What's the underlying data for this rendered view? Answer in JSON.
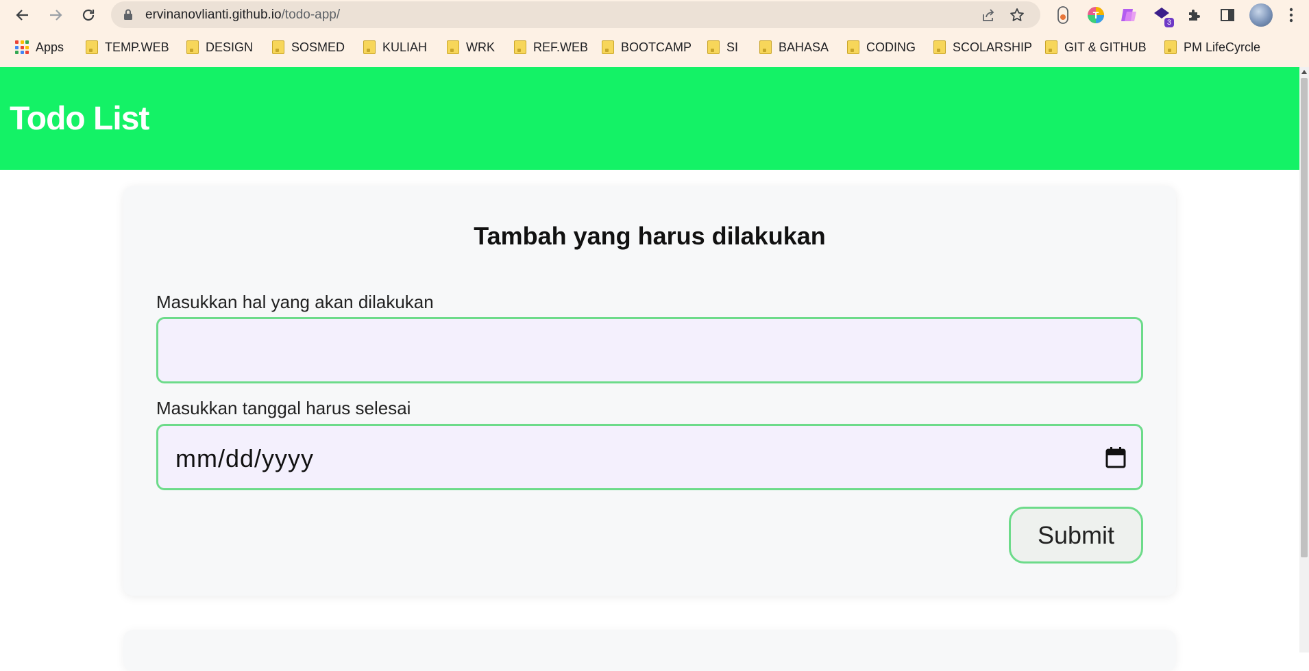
{
  "browser": {
    "url_host": "ervinanovlianti.github.io",
    "url_path": "/todo-app/",
    "extension_badge": "3",
    "bookmarks": [
      {
        "label": "Apps",
        "type": "apps"
      },
      {
        "label": "TEMP.WEB",
        "type": "folder"
      },
      {
        "label": "DESIGN",
        "type": "folder"
      },
      {
        "label": "SOSMED",
        "type": "folder"
      },
      {
        "label": "KULIAH",
        "type": "folder"
      },
      {
        "label": "WRK",
        "type": "folder"
      },
      {
        "label": "REF.WEB",
        "type": "folder"
      },
      {
        "label": "BOOTCAMP",
        "type": "folder"
      },
      {
        "label": "SI",
        "type": "folder"
      },
      {
        "label": "BAHASA",
        "type": "folder"
      },
      {
        "label": "CODING",
        "type": "folder"
      },
      {
        "label": "SCOLARSHIP",
        "type": "folder"
      },
      {
        "label": "GIT & GITHUB",
        "type": "folder"
      },
      {
        "label": "PM LifeCyrcle",
        "type": "folder"
      }
    ]
  },
  "header": {
    "title": "Todo List",
    "background": "#14f266"
  },
  "form": {
    "heading": "Tambah yang harus dilakukan",
    "title_label": "Masukkan hal yang akan dilakukan",
    "title_value": "",
    "date_label": "Masukkan tanggal harus selesai",
    "date_placeholder": "mm/dd/yyyy",
    "submit_label": "Submit",
    "accent": "#6ddb8a"
  }
}
